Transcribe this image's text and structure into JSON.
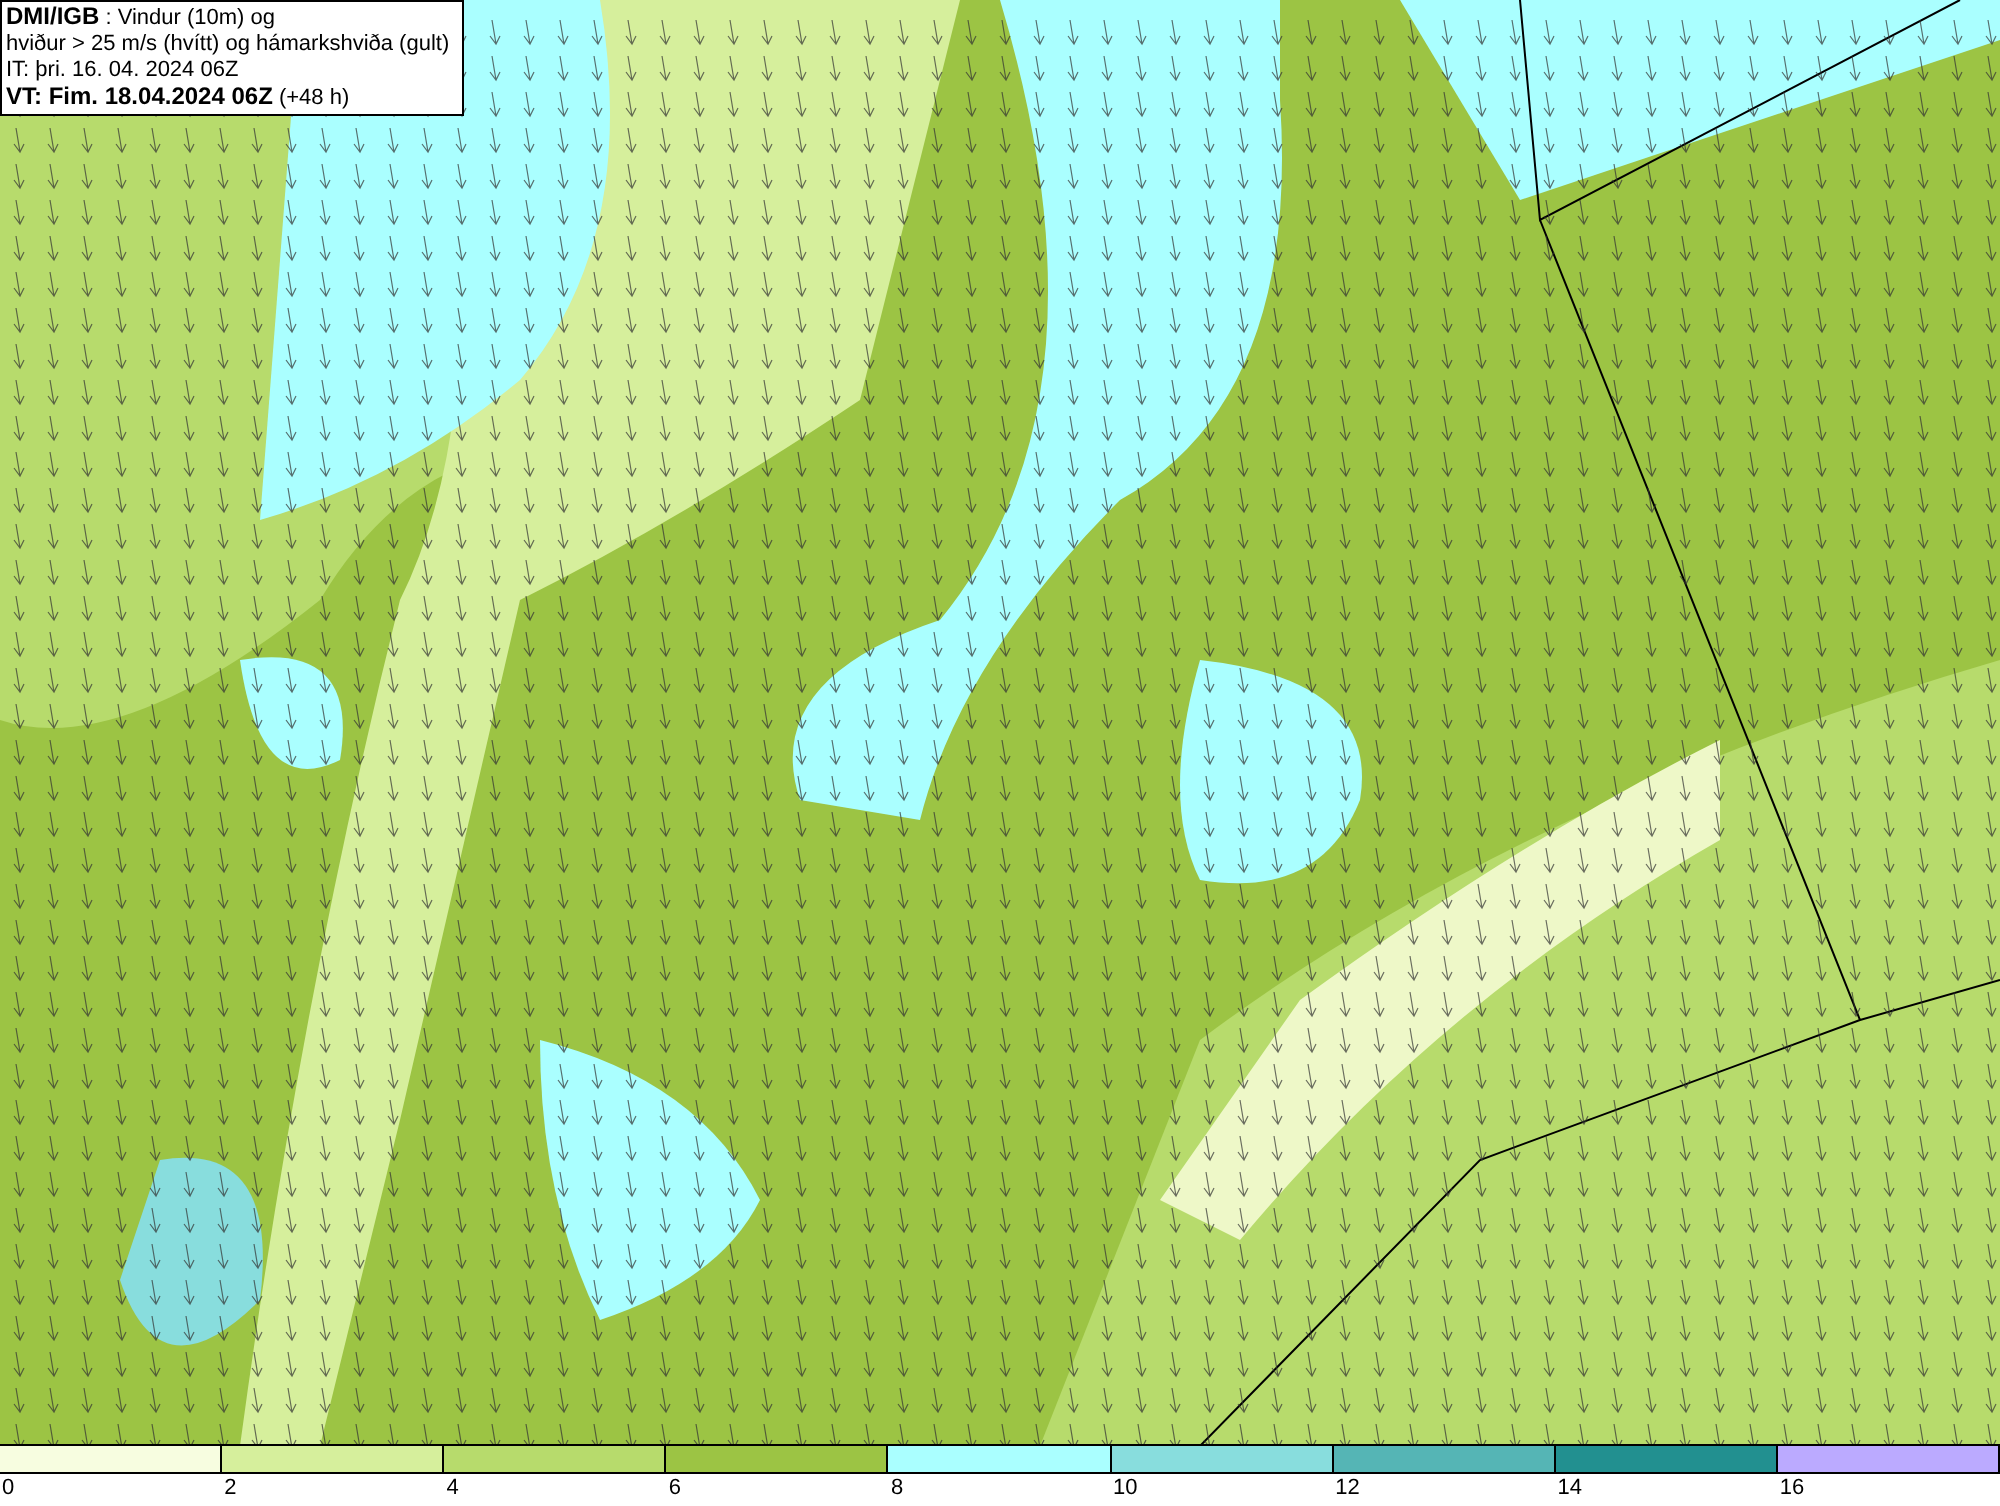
{
  "header": {
    "lines": [
      "**DMI/IGB** : Vindur (10m) og",
      "hviður > 25 m/s (hvítt) og hámarkshviða (gult)",
      "IT: þri. 16. 04. 2024 06Z",
      "**VT: Fim. 18.04.2024 06Z** (+48 h)"
    ]
  },
  "legend": [
    {
      "label": "0",
      "color": "#f7fde0"
    },
    {
      "label": "2",
      "color": "#d6ef9c"
    },
    {
      "label": "4",
      "color": "#b7db6c"
    },
    {
      "label": "6",
      "color": "#9cc444"
    },
    {
      "label": "8",
      "color": "#aaffff"
    },
    {
      "label": "10",
      "color": "#88dddd"
    },
    {
      "label": "12",
      "color": "#55b5b5"
    },
    {
      "label": "14",
      "color": "#229090"
    },
    {
      "label": "16",
      "color": "#bbaaff"
    }
  ]
}
